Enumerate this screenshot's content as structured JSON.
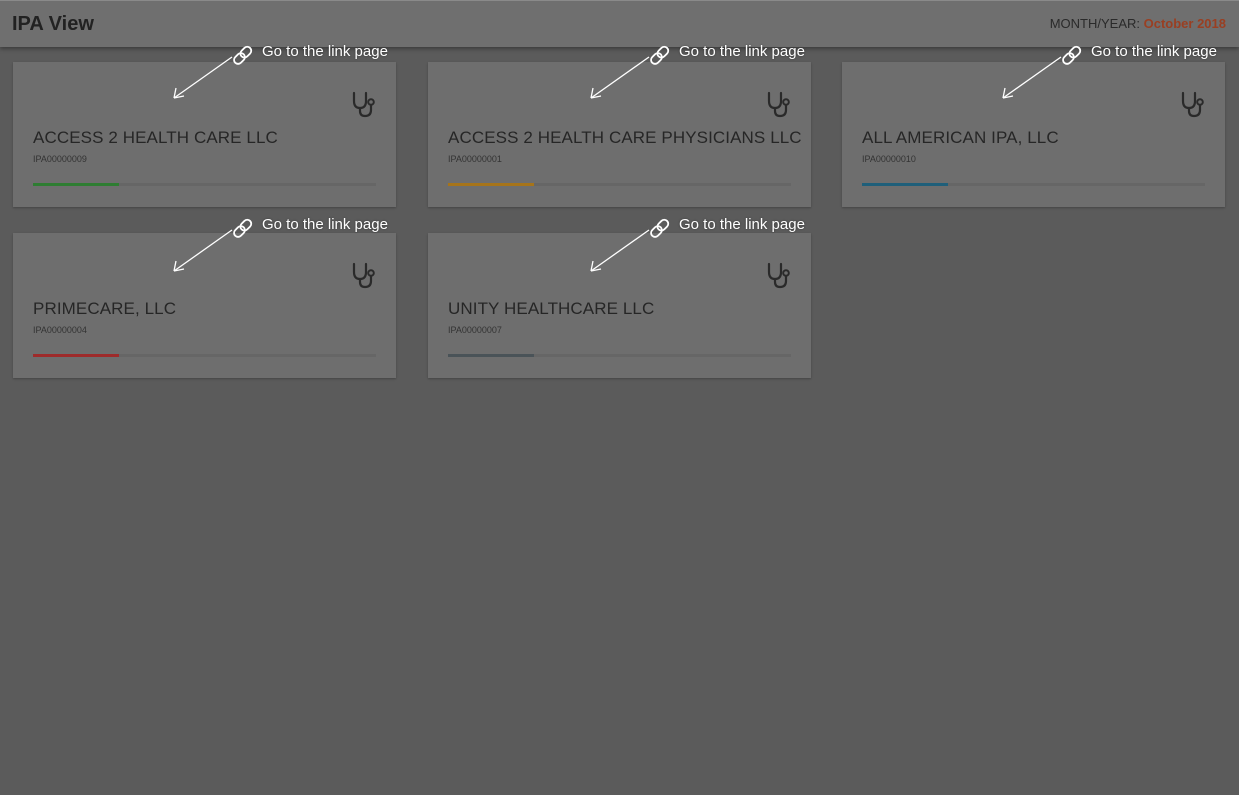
{
  "header": {
    "title": "IPA View",
    "month_label": "MONTH/YEAR:",
    "month_value": "October 2018"
  },
  "annotation_text": "Go to the link page",
  "cards": [
    {
      "name": "ACCESS 2 HEALTH CARE LLC",
      "id": "IPA00000009",
      "progress_color": "#2e7d32",
      "progress": 0.25,
      "icon": "stethoscope-icon"
    },
    {
      "name": "ACCESS 2 HEALTH CARE PHYSICIANS LLC",
      "id": "IPA00000001",
      "progress_color": "#a6741a",
      "progress": 0.25,
      "icon": "stethoscope-icon"
    },
    {
      "name": "ALL AMERICAN IPA, LLC",
      "id": "IPA00000010",
      "progress_color": "#1f5f7a",
      "progress": 0.25,
      "icon": "stethoscope-icon"
    },
    {
      "name": "PRIMECARE, LLC",
      "id": "IPA00000004",
      "progress_color": "#9e2b2b",
      "progress": 0.25,
      "icon": "stethoscope-icon"
    },
    {
      "name": "UNITY HEALTHCARE LLC",
      "id": "IPA00000007",
      "progress_color": "#4a5358",
      "progress": 0.25,
      "icon": "stethoscope-icon"
    }
  ]
}
